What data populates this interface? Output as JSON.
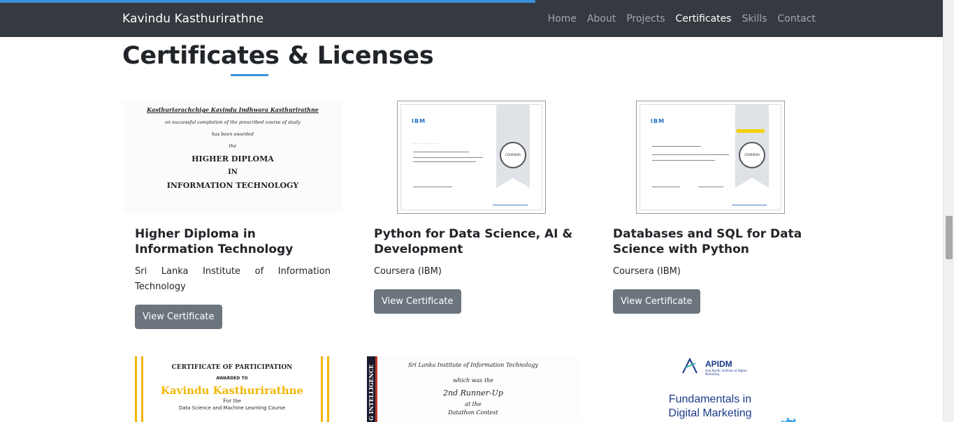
{
  "navbar": {
    "brand": "Kavindu Kasthurirathne",
    "links": [
      "Home",
      "About",
      "Projects",
      "Certificates",
      "Skills",
      "Contact"
    ],
    "active": "Certificates"
  },
  "section": {
    "title": "Certificates & Licenses"
  },
  "certificates": [
    {
      "name": "Higher Diploma in Information Technology",
      "issuer": "Sri Lanka Institute of Information Technology",
      "button": "View Certificate",
      "thumb": {
        "recipient": "Kasthuriarachchige Kavindu Indhwara Kasthurirathne",
        "line1": "on successful completion of the prescribed course of study",
        "line2": "has been awarded",
        "line3": "the",
        "award1": "HIGHER DIPLOMA",
        "award2": "IN",
        "award3": "INFORMATION TECHNOLOGY"
      }
    },
    {
      "name": "Python for Data Science, AI & Development",
      "issuer": "Coursera (IBM)",
      "button": "View Certificate",
      "thumb": {
        "logo": "IBM",
        "seal": "COURSERA"
      }
    },
    {
      "name": "Databases and SQL for Data Science with Python",
      "issuer": "Coursera (IBM)",
      "button": "View Certificate",
      "thumb": {
        "logo": "IBM",
        "seal": "COURSERA"
      }
    }
  ],
  "next_row": {
    "participation": {
      "heading": "CERTIFICATE OF PARTICIPATION",
      "awarded": "AWARDED TO",
      "name": "Kavindu Kasthurirathne",
      "for": "For the",
      "course": "Data Science and Machine Learning Course"
    },
    "runner_up": {
      "side": "G INTELLIGENCE",
      "institute": "Sri Lanka Institute of Information Technology",
      "line1": "which was the",
      "place": "2nd Runner-Up",
      "line2": "at the",
      "line3": "Datathon Contest"
    },
    "apidm": {
      "logo": "APIDM",
      "logo_sub": "Asia Pacific Institute of Digital Marketing",
      "title": "Fundamentals in Digital Marketing"
    }
  },
  "colors": {
    "navbar": "#343a40",
    "accent": "#3b8fd8",
    "button": "#6c757d"
  }
}
